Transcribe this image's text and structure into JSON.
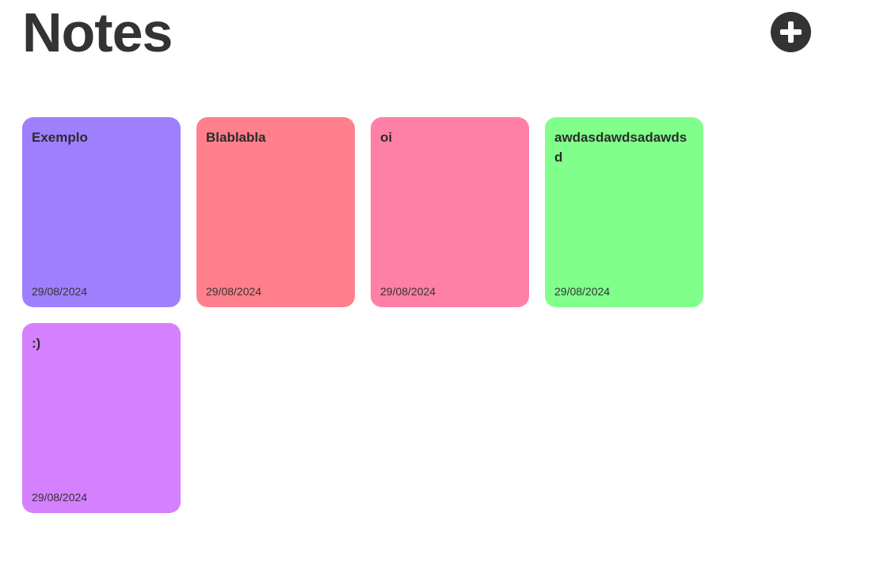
{
  "header": {
    "title": "Notes",
    "add_icon": "plus-circle-icon"
  },
  "notes": [
    {
      "title": "Exemplo",
      "date": "29/08/2024",
      "color": "#9e80ff"
    },
    {
      "title": "Blablabla",
      "date": "29/08/2024",
      "color": "#ff808c"
    },
    {
      "title": "oi",
      "date": "29/08/2024",
      "color": "#ff80a6"
    },
    {
      "title": "awdasdawdsadawdsd",
      "date": "29/08/2024",
      "color": "#80ff8a"
    },
    {
      "title": ":)",
      "date": "29/08/2024",
      "color": "#d580ff"
    }
  ]
}
